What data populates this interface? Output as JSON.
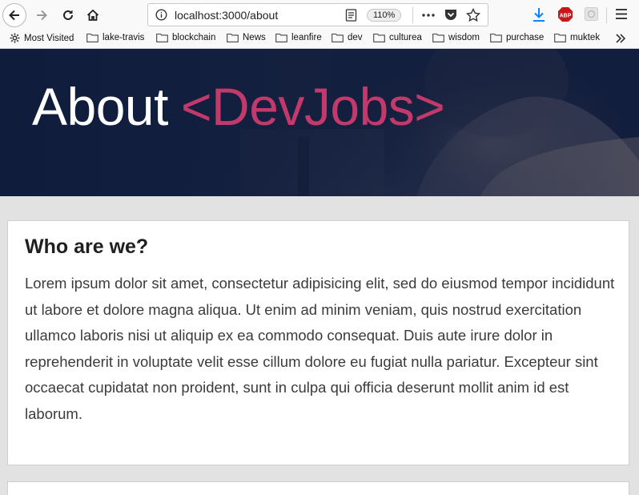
{
  "browser": {
    "url": "localhost:3000/about",
    "zoom": "110%",
    "bookmarks": [
      "Most Visited",
      "lake-travis",
      "blockchain",
      "News",
      "leanfire",
      "dev",
      "culturea",
      "wisdom",
      "purchase",
      "muktek"
    ],
    "icons": [
      "back-arrow-icon",
      "forward-arrow-icon",
      "reload-icon",
      "home-icon",
      "info-icon",
      "reader-view-icon",
      "more-icon",
      "pocket-icon",
      "star-icon",
      "download-icon",
      "adblock-icon",
      "extension-icon",
      "hamburger-menu-icon",
      "gear-icon",
      "folder-icon",
      "chevrons-right-icon"
    ]
  },
  "hero": {
    "title_about": "About",
    "title_brand": "<DevJobs>",
    "brand_color": "#c2396b",
    "bg_color": "#0f1c3c"
  },
  "sections": [
    {
      "heading": "Who are we?",
      "body": "Lorem ipsum dolor sit amet, consectetur adipisicing elit, sed do eiusmod tempor incididunt ut labore et dolore magna aliqua. Ut enim ad minim veniam, quis nostrud exercitation ullamco laboris nisi ut aliquip ex ea commodo consequat. Duis aute irure dolor in reprehenderit in voluptate velit esse cillum dolore eu fugiat nulla pariatur. Excepteur sint occaecat cupidatat non proident, sunt in culpa qui officia deserunt mollit anim id est laborum."
    }
  ]
}
